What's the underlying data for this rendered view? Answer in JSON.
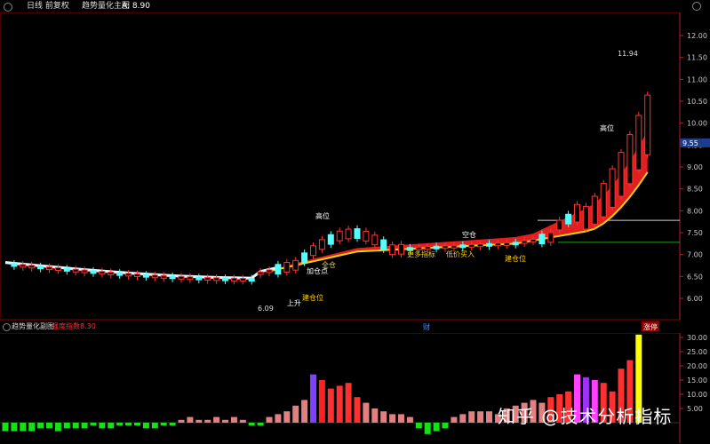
{
  "header": {
    "title": "日线 前复权",
    "indicator": "趋势量化主图",
    "a_label": "A: 8.90",
    "a_value": "8.90"
  },
  "subheader": {
    "name": "趋势量化副图",
    "metric": "强度指数",
    "value": "8.30"
  },
  "watermark": "知乎 @技术分析指标",
  "price_chart": {
    "type": "candlestick",
    "y_ticks": [
      "12.00",
      "11.50",
      "11.00",
      "10.50",
      "10.00",
      "9.50",
      "9.00",
      "8.50",
      "8.00",
      "7.50",
      "7.00",
      "6.50",
      "6.00"
    ],
    "ylim": [
      5.75,
      12.25
    ],
    "current_price": "9.55",
    "high_label": "11.94",
    "low_label": "6.09",
    "ref_line_white": 7.78,
    "ref_line_green": 7.28,
    "annotations": [
      "高位",
      "加仓点",
      "全仓",
      "建仓位",
      "上升",
      "更多指标",
      "低价买入",
      "空仓",
      "建仓位",
      "高位"
    ],
    "bottom_marks": [
      "财",
      "涨停"
    ]
  },
  "chart_data": {
    "type": "bar",
    "subtitle": "强度指数",
    "y_ticks": [
      "30.00",
      "25.00",
      "20.00",
      "15.00",
      "10.00",
      "5.00"
    ],
    "ylim": [
      -4,
      32
    ],
    "values": [
      -3,
      -3,
      -3,
      -3,
      -2,
      -2,
      -3,
      -2,
      -2,
      -2,
      -1,
      -2,
      -2,
      -1,
      -1,
      -1,
      -2,
      -2,
      -1,
      -1,
      1,
      2,
      1,
      1,
      2,
      1,
      2,
      1,
      -1,
      -1,
      2,
      3,
      4,
      6,
      8,
      17,
      15,
      12,
      13,
      14,
      9,
      7,
      5,
      4,
      3,
      3,
      2,
      -2,
      -4,
      -3,
      -2,
      2,
      3,
      4,
      4,
      4,
      3,
      5,
      6,
      7,
      8,
      7,
      9,
      10,
      11,
      17,
      16,
      15,
      14,
      11,
      19,
      22,
      31
    ]
  }
}
